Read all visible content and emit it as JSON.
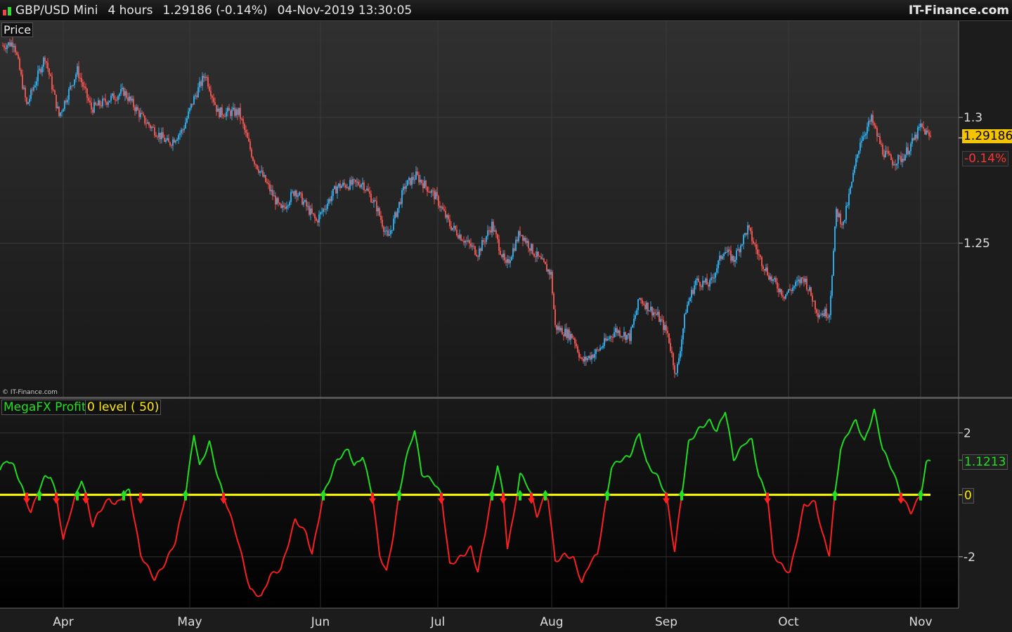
{
  "header": {
    "symbol": "GBP/USD Mini",
    "timeframe": "4 hours",
    "last": "1.29186 (-0.14%)",
    "datetime": "04-Nov-2019 13:30:05",
    "brand": "IT-Finance.com"
  },
  "price_panel": {
    "label": "Price",
    "copyright": "© IT-Finance.com",
    "last_price": "1.29186",
    "change": "-0.14%"
  },
  "indicator_panel": {
    "name": "MegaFX Profit",
    "level_label": "0 level ( 50)",
    "last_value": "1.1213",
    "zero_label": "0"
  },
  "colors": {
    "up": "#2aa8e6",
    "down": "#e8524c",
    "osc_pos": "#22e022",
    "osc_neg": "#ff2020",
    "zero_line": "#ffff00",
    "last_bg": "#f5c400"
  },
  "chart_data": [
    {
      "type": "candlestick",
      "title": "GBP/USD Mini 4 hours",
      "ylabel": "Price",
      "ylim": [
        1.1889,
        1.3383
      ],
      "yticks": [
        {
          "value": 1.3,
          "label": "1.3"
        },
        {
          "value": 1.25,
          "label": "1.25"
        }
      ],
      "x_domain": [
        0,
        341
      ],
      "xticks": [
        {
          "t": 22.5,
          "label": "Apr"
        },
        {
          "t": 67.5,
          "label": "May"
        },
        {
          "t": 114,
          "label": "Jun"
        },
        {
          "t": 155.75,
          "label": "Jul"
        },
        {
          "t": 196.25,
          "label": "Aug"
        },
        {
          "t": 237,
          "label": "Sep"
        },
        {
          "t": 280.5,
          "label": "Oct"
        },
        {
          "t": 327.5,
          "label": "Nov"
        }
      ],
      "close_path": [
        [
          1,
          1.3285
        ],
        [
          5,
          1.3299
        ],
        [
          9.5,
          1.3047
        ],
        [
          16,
          1.3243
        ],
        [
          21,
          1.3006
        ],
        [
          27.5,
          1.3187
        ],
        [
          32.5,
          1.3034
        ],
        [
          44,
          1.3103
        ],
        [
          51,
          1.2992
        ],
        [
          60,
          1.2894
        ],
        [
          65,
          1.295
        ],
        [
          69,
          1.3075
        ],
        [
          73,
          1.3173
        ],
        [
          77.5,
          1.302
        ],
        [
          85,
          1.302
        ],
        [
          90,
          1.2838
        ],
        [
          96,
          1.2712
        ],
        [
          100,
          1.2628
        ],
        [
          105,
          1.2712
        ],
        [
          112.5,
          1.2587
        ],
        [
          120,
          1.2726
        ],
        [
          129,
          1.274
        ],
        [
          134,
          1.2642
        ],
        [
          138,
          1.2517
        ],
        [
          144,
          1.2726
        ],
        [
          148,
          1.2768
        ],
        [
          155,
          1.2684
        ],
        [
          160,
          1.2573
        ],
        [
          166,
          1.2503
        ],
        [
          170,
          1.2461
        ],
        [
          175,
          1.2573
        ],
        [
          180,
          1.2405
        ],
        [
          185,
          1.2545
        ],
        [
          190,
          1.2461
        ],
        [
          196,
          1.2377
        ],
        [
          197.5,
          1.2168
        ],
        [
          204,
          1.2126
        ],
        [
          207,
          1.2028
        ],
        [
          212.5,
          1.207
        ],
        [
          219,
          1.2154
        ],
        [
          224,
          1.2126
        ],
        [
          227.5,
          1.2279
        ],
        [
          234,
          1.2209
        ],
        [
          237.5,
          1.214
        ],
        [
          240.5,
          1.1972
        ],
        [
          244,
          1.2237
        ],
        [
          247.5,
          1.2349
        ],
        [
          252.5,
          1.2335
        ],
        [
          257.5,
          1.2475
        ],
        [
          261,
          1.2433
        ],
        [
          266,
          1.2559
        ],
        [
          270,
          1.2447
        ],
        [
          274,
          1.2363
        ],
        [
          279,
          1.2293
        ],
        [
          286,
          1.2363
        ],
        [
          291,
          1.2223
        ],
        [
          295,
          1.2223
        ],
        [
          297.5,
          1.2628
        ],
        [
          300,
          1.2573
        ],
        [
          304,
          1.2796
        ],
        [
          306,
          1.2908
        ],
        [
          310,
          1.2992
        ],
        [
          314,
          1.2866
        ],
        [
          317.5,
          1.2824
        ],
        [
          321,
          1.2838
        ],
        [
          325,
          1.2908
        ],
        [
          327.5,
          1.2964
        ],
        [
          331,
          1.29186
        ]
      ]
    },
    {
      "type": "line",
      "title": "MegaFX Profit",
      "ylim": [
        -3.66,
        3.1
      ],
      "yticks": [
        {
          "value": 2,
          "label": "2"
        },
        {
          "value": -2,
          "label": "-2"
        }
      ],
      "zero_level": 0,
      "series": [
        {
          "name": "MegaFX Profit",
          "points": [
            [
              0,
              0.8
            ],
            [
              2.5,
              1.14
            ],
            [
              5,
              0.91
            ],
            [
              7.5,
              0.34
            ],
            [
              9.5,
              -0.23
            ],
            [
              11,
              -0.57
            ],
            [
              14,
              0.2
            ],
            [
              16,
              0.57
            ],
            [
              18,
              0.61
            ],
            [
              20,
              0
            ],
            [
              22.5,
              -1.48
            ],
            [
              25,
              -0.57
            ],
            [
              27.5,
              0.11
            ],
            [
              29,
              0.5
            ],
            [
              30.5,
              0
            ],
            [
              33,
              -1.02
            ],
            [
              35,
              -0.57
            ],
            [
              39,
              -0.11
            ],
            [
              41,
              -0.34
            ],
            [
              44,
              0
            ],
            [
              46,
              0.16
            ],
            [
              50,
              -1.93
            ],
            [
              55,
              -2.73
            ],
            [
              59,
              -2.16
            ],
            [
              62.5,
              -1.48
            ],
            [
              66,
              0
            ],
            [
              69,
              1.98
            ],
            [
              71,
              0.91
            ],
            [
              74.5,
              1.7
            ],
            [
              77.5,
              0.57
            ],
            [
              79.5,
              0
            ],
            [
              84,
              -1.25
            ],
            [
              89,
              -3.07
            ],
            [
              93,
              -3.3
            ],
            [
              96,
              -2.61
            ],
            [
              100,
              -2.39
            ],
            [
              105,
              -0.8
            ],
            [
              109,
              -1.25
            ],
            [
              111,
              -1.93
            ],
            [
              115,
              0
            ],
            [
              117.5,
              0.57
            ],
            [
              120,
              1.14
            ],
            [
              124,
              1.48
            ],
            [
              126,
              0.91
            ],
            [
              129,
              1.25
            ],
            [
              132.5,
              0
            ],
            [
              135,
              -1.93
            ],
            [
              137.5,
              -2.5
            ],
            [
              140,
              -1.25
            ],
            [
              142,
              0
            ],
            [
              144,
              1.02
            ],
            [
              147.5,
              2.11
            ],
            [
              150,
              0.68
            ],
            [
              154,
              0.45
            ],
            [
              157,
              0
            ],
            [
              160,
              -2.27
            ],
            [
              165,
              -1.93
            ],
            [
              167.5,
              -1.7
            ],
            [
              170,
              -2.5
            ],
            [
              172.5,
              -1.25
            ],
            [
              175,
              0
            ],
            [
              177,
              0.98
            ],
            [
              179,
              0
            ],
            [
              180.5,
              -1.7
            ],
            [
              182.5,
              -0.8
            ],
            [
              185,
              0.68
            ],
            [
              187.5,
              0.34
            ],
            [
              189,
              0
            ],
            [
              191,
              -0.68
            ],
            [
              194,
              0
            ],
            [
              195,
              -0.11
            ],
            [
              197.5,
              -2.16
            ],
            [
              201,
              -1.93
            ],
            [
              204,
              -2.05
            ],
            [
              207,
              -2.84
            ],
            [
              210,
              -2.16
            ],
            [
              212.5,
              -1.93
            ],
            [
              216,
              0
            ],
            [
              217.5,
              0.91
            ],
            [
              221,
              1.14
            ],
            [
              224,
              1.25
            ],
            [
              227.5,
              2.0
            ],
            [
              230,
              1.02
            ],
            [
              234,
              0.57
            ],
            [
              237,
              0
            ],
            [
              240,
              -1.82
            ],
            [
              242.5,
              0
            ],
            [
              245,
              1.7
            ],
            [
              249,
              2.16
            ],
            [
              252.5,
              2.39
            ],
            [
              255,
              2.05
            ],
            [
              258,
              2.73
            ],
            [
              261,
              1.14
            ],
            [
              265,
              1.7
            ],
            [
              267.5,
              1.77
            ],
            [
              270,
              0.57
            ],
            [
              273,
              0
            ],
            [
              275,
              -1.93
            ],
            [
              279,
              -2.39
            ],
            [
              281,
              -2.5
            ],
            [
              284,
              -1.25
            ],
            [
              286,
              -0.34
            ],
            [
              290,
              -0.23
            ],
            [
              292.5,
              -1.25
            ],
            [
              295,
              -1.93
            ],
            [
              297,
              0
            ],
            [
              299,
              1.48
            ],
            [
              302.5,
              2.16
            ],
            [
              304.5,
              2.39
            ],
            [
              307.5,
              1.7
            ],
            [
              311,
              2.73
            ],
            [
              314,
              1.48
            ],
            [
              317.5,
              0.8
            ],
            [
              320.5,
              0
            ],
            [
              324,
              -0.57
            ],
            [
              327.5,
              0
            ],
            [
              329.5,
              1.02
            ],
            [
              331,
              1.1213
            ]
          ]
        }
      ]
    }
  ]
}
